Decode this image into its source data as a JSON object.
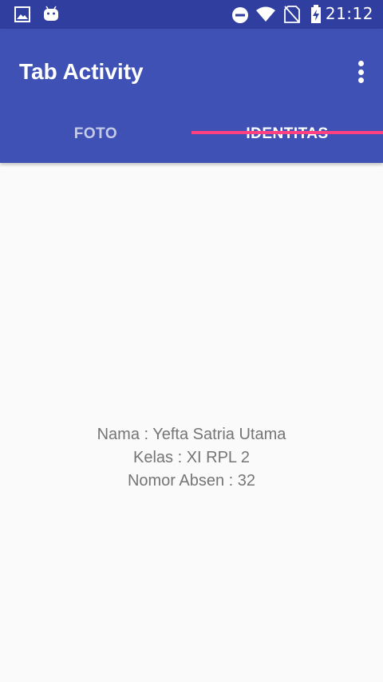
{
  "status_bar": {
    "time": "21:12",
    "icons": [
      "image-icon",
      "android-icon",
      "do-not-disturb-icon",
      "wifi-icon",
      "no-sim-icon",
      "battery-charging-icon"
    ]
  },
  "toolbar": {
    "title": "Tab Activity",
    "overflow_icon": "more-vert-icon"
  },
  "tabs": [
    {
      "label": "FOTO",
      "selected": false
    },
    {
      "label": "IDENTITAS",
      "selected": true
    }
  ],
  "identity": {
    "name_line": "Nama : Yefta Satria Utama",
    "class_line": "Kelas : XI RPL 2",
    "number_line": "Nomor Absen : 32"
  },
  "colors": {
    "status_bar": "#303f9f",
    "app_bar": "#3f51b5",
    "tab_indicator": "#ff4081",
    "background": "#fafafa",
    "content_text": "#757575"
  }
}
